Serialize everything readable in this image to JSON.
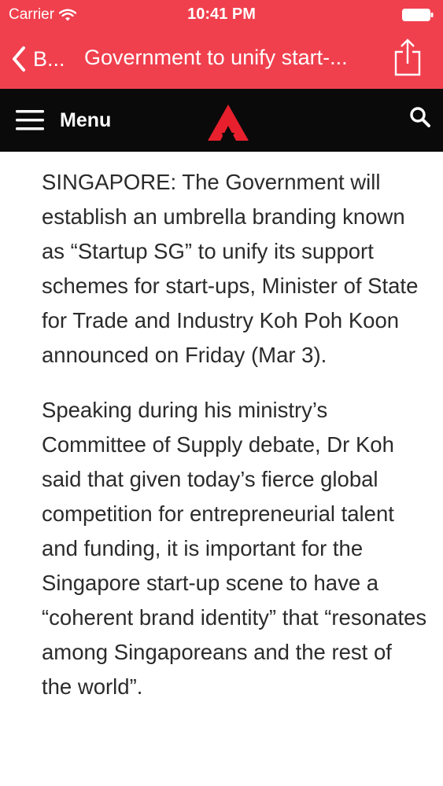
{
  "status_bar": {
    "carrier": "Carrier",
    "time": "10:41 PM"
  },
  "nav": {
    "back_label": "B...",
    "title": "Government to unify start-..."
  },
  "header": {
    "menu_label": "Menu"
  },
  "colors": {
    "nav_background": "#f0404e",
    "header_background": "#0a0a0a",
    "logo_red": "#e8202d"
  },
  "article": {
    "paragraphs": [
      "SINGAPORE: The Government will establish an umbrella branding known as “Startup SG” to unify its support schemes for start-ups, Minister of State for Trade and Industry Koh Poh Koon announced on Friday (Mar 3).",
      "Speaking during his ministry’s Committee of Supply debate, Dr Koh said that given today’s fierce global competition for entrepreneurial talent and funding, it is important for the Singapore start-up scene to have a “coherent brand identity” that “resonates among Singaporeans and the rest of the world”."
    ]
  }
}
